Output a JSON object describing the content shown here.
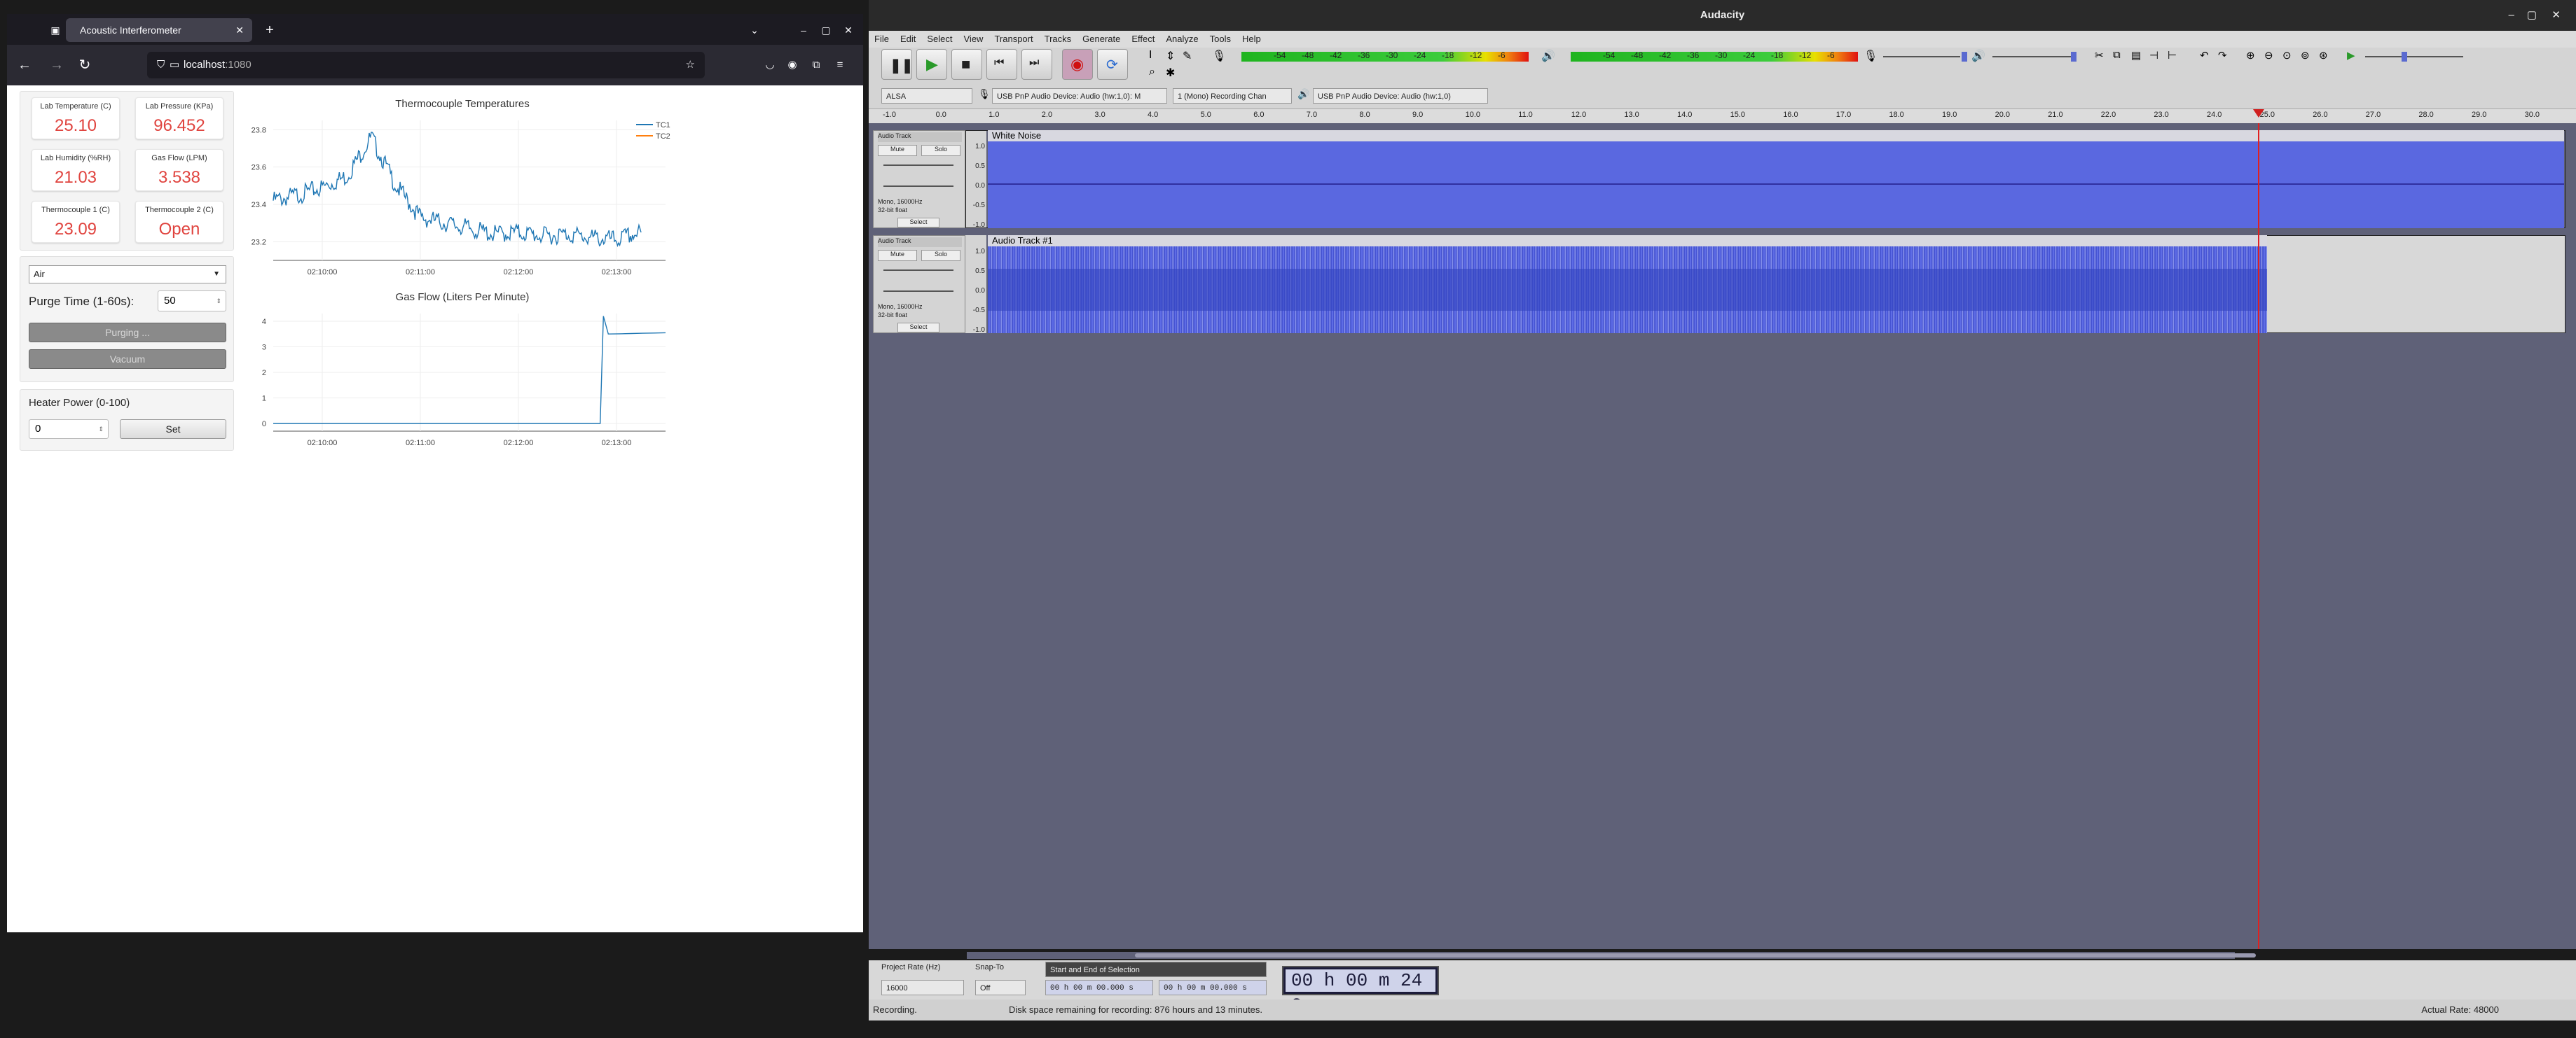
{
  "browser": {
    "tab_title": "Acoustic Interferometer",
    "url_host": "localhost",
    "url_port": ":1080"
  },
  "stats": [
    {
      "label": "Lab Temperature (C)",
      "value": "25.10"
    },
    {
      "label": "Lab Pressure (KPa)",
      "value": "96.452"
    },
    {
      "label": "Lab Humidity (%RH)",
      "value": "21.03"
    },
    {
      "label": "Gas Flow (LPM)",
      "value": "3.538"
    },
    {
      "label": "Thermocouple 1 (C)",
      "value": "23.09"
    },
    {
      "label": "Thermocouple 2 (C)",
      "value": "Open"
    }
  ],
  "controls": {
    "gas_select": "Air",
    "purge_label": "Purge Time (1-60s):",
    "purge_value": "50",
    "purge_button": "Purging ...",
    "vacuum_button": "Vacuum",
    "heater_label": "Heater Power (0-100)",
    "heater_value": "0",
    "set_button": "Set"
  },
  "chart_data": [
    {
      "type": "line",
      "title": "Thermocouple Temperatures",
      "legend": [
        "TC1",
        "TC2"
      ],
      "ylim": [
        23.1,
        23.85
      ],
      "yticks": [
        "23.8",
        "23.6",
        "23.4",
        "23.2"
      ],
      "xticks": [
        "02:10:00",
        "02:11:00",
        "02:12:00",
        "02:13:00"
      ],
      "series": [
        {
          "name": "TC1",
          "color": "#1f77b4",
          "x": [
            "02:09:30",
            "02:09:45",
            "02:10:00",
            "02:10:15",
            "02:10:30",
            "02:10:45",
            "02:11:00",
            "02:11:15",
            "02:11:30",
            "02:11:45",
            "02:12:00",
            "02:12:15",
            "02:12:30",
            "02:12:45",
            "02:13:00",
            "02:13:15"
          ],
          "values": [
            23.42,
            23.45,
            23.49,
            23.55,
            23.76,
            23.5,
            23.33,
            23.3,
            23.27,
            23.24,
            23.25,
            23.23,
            23.24,
            23.22,
            23.21,
            23.25
          ]
        },
        {
          "name": "TC2",
          "color": "#ff7f0e",
          "x": [],
          "values": []
        }
      ]
    },
    {
      "type": "line",
      "title": "Gas Flow (Liters Per Minute)",
      "ylim": [
        -0.3,
        4.3
      ],
      "yticks": [
        "4",
        "3",
        "2",
        "1",
        "0"
      ],
      "xticks": [
        "02:10:00",
        "02:11:00",
        "02:12:00",
        "02:13:00"
      ],
      "series": [
        {
          "color": "#1f77b4",
          "x": [
            "02:09:30",
            "02:12:50",
            "02:12:52",
            "02:12:55",
            "02:13:30"
          ],
          "values": [
            0,
            0,
            4.2,
            3.5,
            3.55
          ]
        }
      ]
    }
  ],
  "audacity": {
    "title": "Audacity",
    "menu": [
      "File",
      "Edit",
      "Select",
      "View",
      "Transport",
      "Tracks",
      "Generate",
      "Effect",
      "Analyze",
      "Tools",
      "Help"
    ],
    "meter_ticks": [
      "-54",
      "-48",
      "-42",
      "-36",
      "-30",
      "-24",
      "-18",
      "-12",
      "-6"
    ],
    "device_host": "ALSA",
    "rec_device": "USB PnP Audio Device: Audio (hw:1,0): M",
    "channels": "1 (Mono) Recording Chan",
    "play_device": "USB PnP Audio Device: Audio (hw:1,0)",
    "ruler": [
      "-1.0",
      "0.0",
      "1.0",
      "2.0",
      "3.0",
      "4.0",
      "5.0",
      "6.0",
      "7.0",
      "8.0",
      "9.0",
      "10.0",
      "11.0",
      "12.0",
      "13.0",
      "14.0",
      "15.0",
      "16.0",
      "17.0",
      "18.0",
      "19.0",
      "20.0",
      "21.0",
      "22.0",
      "23.0",
      "24.0",
      "25.0",
      "26.0",
      "27.0",
      "28.0",
      "29.0",
      "30.0"
    ],
    "tracks": [
      {
        "name": "White Noise",
        "header": "Audio Track",
        "info1": "Mono, 16000Hz",
        "info2": "32-bit float"
      },
      {
        "name": "Audio Track #1",
        "header": "Audio Track",
        "info1": "Mono, 16000Hz",
        "info2": "32-bit float"
      }
    ],
    "amp_ticks": [
      "1.0",
      "0.5",
      "0.0",
      "-0.5",
      "-1.0"
    ],
    "mute": "Mute",
    "solo": "Solo",
    "select": "Select",
    "project_rate_label": "Project Rate (Hz)",
    "project_rate": "16000",
    "snap_label": "Snap-To",
    "snap": "Off",
    "selection_mode": "Start and End of Selection",
    "sel_start": "00 h 00 m 00.000 s",
    "sel_end": "00 h 00 m 00.000 s",
    "big_time": "00 h 00 m 24 s",
    "status_left": "Recording.",
    "status_mid": "Disk space remaining for recording: 876 hours and 13 minutes.",
    "status_right": "Actual Rate: 48000"
  }
}
